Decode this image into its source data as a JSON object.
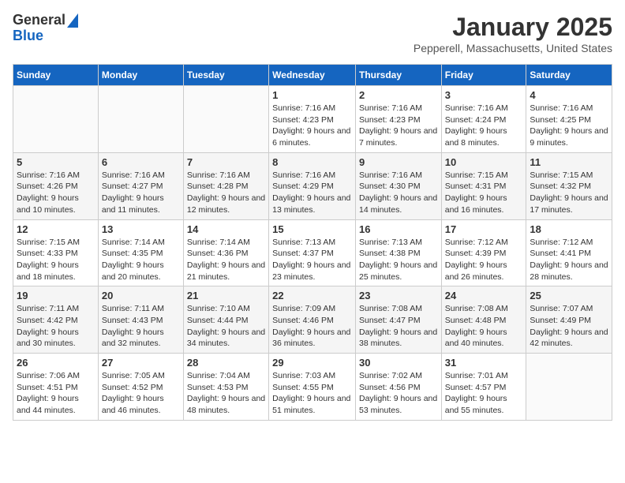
{
  "header": {
    "logo_line1": "General",
    "logo_line2": "Blue",
    "title": "January 2025",
    "subtitle": "Pepperell, Massachusetts, United States"
  },
  "days_of_week": [
    "Sunday",
    "Monday",
    "Tuesday",
    "Wednesday",
    "Thursday",
    "Friday",
    "Saturday"
  ],
  "weeks": [
    [
      {
        "day": "",
        "info": ""
      },
      {
        "day": "",
        "info": ""
      },
      {
        "day": "",
        "info": ""
      },
      {
        "day": "1",
        "info": "Sunrise: 7:16 AM\nSunset: 4:23 PM\nDaylight: 9 hours and 6 minutes."
      },
      {
        "day": "2",
        "info": "Sunrise: 7:16 AM\nSunset: 4:23 PM\nDaylight: 9 hours and 7 minutes."
      },
      {
        "day": "3",
        "info": "Sunrise: 7:16 AM\nSunset: 4:24 PM\nDaylight: 9 hours and 8 minutes."
      },
      {
        "day": "4",
        "info": "Sunrise: 7:16 AM\nSunset: 4:25 PM\nDaylight: 9 hours and 9 minutes."
      }
    ],
    [
      {
        "day": "5",
        "info": "Sunrise: 7:16 AM\nSunset: 4:26 PM\nDaylight: 9 hours and 10 minutes."
      },
      {
        "day": "6",
        "info": "Sunrise: 7:16 AM\nSunset: 4:27 PM\nDaylight: 9 hours and 11 minutes."
      },
      {
        "day": "7",
        "info": "Sunrise: 7:16 AM\nSunset: 4:28 PM\nDaylight: 9 hours and 12 minutes."
      },
      {
        "day": "8",
        "info": "Sunrise: 7:16 AM\nSunset: 4:29 PM\nDaylight: 9 hours and 13 minutes."
      },
      {
        "day": "9",
        "info": "Sunrise: 7:16 AM\nSunset: 4:30 PM\nDaylight: 9 hours and 14 minutes."
      },
      {
        "day": "10",
        "info": "Sunrise: 7:15 AM\nSunset: 4:31 PM\nDaylight: 9 hours and 16 minutes."
      },
      {
        "day": "11",
        "info": "Sunrise: 7:15 AM\nSunset: 4:32 PM\nDaylight: 9 hours and 17 minutes."
      }
    ],
    [
      {
        "day": "12",
        "info": "Sunrise: 7:15 AM\nSunset: 4:33 PM\nDaylight: 9 hours and 18 minutes."
      },
      {
        "day": "13",
        "info": "Sunrise: 7:14 AM\nSunset: 4:35 PM\nDaylight: 9 hours and 20 minutes."
      },
      {
        "day": "14",
        "info": "Sunrise: 7:14 AM\nSunset: 4:36 PM\nDaylight: 9 hours and 21 minutes."
      },
      {
        "day": "15",
        "info": "Sunrise: 7:13 AM\nSunset: 4:37 PM\nDaylight: 9 hours and 23 minutes."
      },
      {
        "day": "16",
        "info": "Sunrise: 7:13 AM\nSunset: 4:38 PM\nDaylight: 9 hours and 25 minutes."
      },
      {
        "day": "17",
        "info": "Sunrise: 7:12 AM\nSunset: 4:39 PM\nDaylight: 9 hours and 26 minutes."
      },
      {
        "day": "18",
        "info": "Sunrise: 7:12 AM\nSunset: 4:41 PM\nDaylight: 9 hours and 28 minutes."
      }
    ],
    [
      {
        "day": "19",
        "info": "Sunrise: 7:11 AM\nSunset: 4:42 PM\nDaylight: 9 hours and 30 minutes."
      },
      {
        "day": "20",
        "info": "Sunrise: 7:11 AM\nSunset: 4:43 PM\nDaylight: 9 hours and 32 minutes."
      },
      {
        "day": "21",
        "info": "Sunrise: 7:10 AM\nSunset: 4:44 PM\nDaylight: 9 hours and 34 minutes."
      },
      {
        "day": "22",
        "info": "Sunrise: 7:09 AM\nSunset: 4:46 PM\nDaylight: 9 hours and 36 minutes."
      },
      {
        "day": "23",
        "info": "Sunrise: 7:08 AM\nSunset: 4:47 PM\nDaylight: 9 hours and 38 minutes."
      },
      {
        "day": "24",
        "info": "Sunrise: 7:08 AM\nSunset: 4:48 PM\nDaylight: 9 hours and 40 minutes."
      },
      {
        "day": "25",
        "info": "Sunrise: 7:07 AM\nSunset: 4:49 PM\nDaylight: 9 hours and 42 minutes."
      }
    ],
    [
      {
        "day": "26",
        "info": "Sunrise: 7:06 AM\nSunset: 4:51 PM\nDaylight: 9 hours and 44 minutes."
      },
      {
        "day": "27",
        "info": "Sunrise: 7:05 AM\nSunset: 4:52 PM\nDaylight: 9 hours and 46 minutes."
      },
      {
        "day": "28",
        "info": "Sunrise: 7:04 AM\nSunset: 4:53 PM\nDaylight: 9 hours and 48 minutes."
      },
      {
        "day": "29",
        "info": "Sunrise: 7:03 AM\nSunset: 4:55 PM\nDaylight: 9 hours and 51 minutes."
      },
      {
        "day": "30",
        "info": "Sunrise: 7:02 AM\nSunset: 4:56 PM\nDaylight: 9 hours and 53 minutes."
      },
      {
        "day": "31",
        "info": "Sunrise: 7:01 AM\nSunset: 4:57 PM\nDaylight: 9 hours and 55 minutes."
      },
      {
        "day": "",
        "info": ""
      }
    ]
  ]
}
